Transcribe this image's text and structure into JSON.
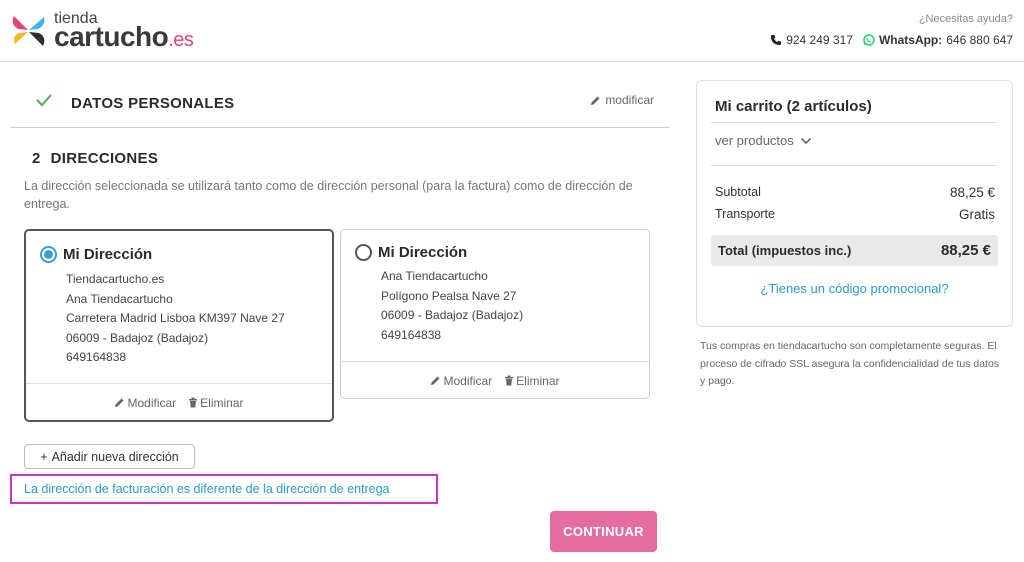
{
  "header": {
    "logo_top": "tienda",
    "logo_main": "cartucho",
    "logo_tld": ".es",
    "help_text": "¿Necesitas ayuda?",
    "phone": "924 249 317",
    "whatsapp_label": "WhatsApp:",
    "whatsapp_number": "646 880 647"
  },
  "step1": {
    "title": "DATOS PERSONALES",
    "modify_label": "modificar"
  },
  "step2": {
    "number": "2",
    "title": "DIRECCIONES",
    "description": "La dirección seleccionada se utilizará tanto como de dirección personal (para la factura) como de dirección de entrega."
  },
  "addresses": [
    {
      "name": "Mi Dirección",
      "selected": true,
      "lines": [
        "Tiendacartucho.es",
        "Ana Tiendacartucho",
        "Carretera Madrid Lisboa KM397 Nave 27",
        "06009 - Badajoz (Badajoz)",
        "649164838"
      ],
      "modify_label": "Modificar",
      "delete_label": "Eliminar"
    },
    {
      "name": "Mi Dirección",
      "selected": false,
      "lines": [
        "Ana Tiendacartucho",
        "Polígono Pealsa Nave 27",
        "06009 - Badajoz (Badajoz)",
        "649164838"
      ],
      "modify_label": "Modificar",
      "delete_label": "Eliminar"
    }
  ],
  "add_address_label": "Añadir nueva dirección",
  "billing_link": "La dirección de facturación es diferente de la dirección de entrega",
  "continue_label": "CONTINUAR",
  "cart": {
    "title": "Mi carrito (2 artículos)",
    "view_products": "ver productos",
    "subtotal_label": "Subtotal",
    "subtotal_value": "88,25 €",
    "shipping_label": "Transporte",
    "shipping_value": "Gratis",
    "total_label": "Total (impuestos inc.)",
    "total_value": "88,25 €",
    "promo_link": "¿Tienes un código promocional?"
  },
  "secure_note": "Tus compras en tiendacartucho son completamente seguras. El proceso de cifrado SSL asegura la confidencialidad de tus datos y pago.",
  "colors": {
    "accent_pink": "#e46c9e",
    "link_blue": "#2a9ad0",
    "check_green": "#4caf50",
    "radio_blue": "#3aa0d0",
    "highlight_magenta": "#cc33cc"
  }
}
